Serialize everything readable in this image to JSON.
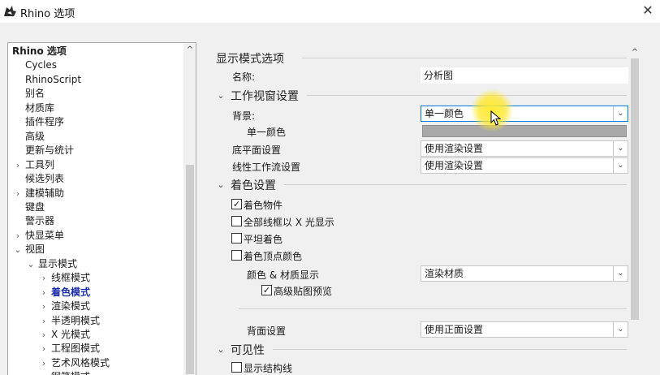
{
  "window": {
    "title": "Rhino 选项",
    "close_glyph": "✕",
    "icon": "rhino-icon"
  },
  "tree": {
    "items": [
      {
        "label": "Rhino 选项",
        "bold": true
      },
      {
        "label": "Cycles"
      },
      {
        "label": "RhinoScript"
      },
      {
        "label": "别名"
      },
      {
        "label": "材质库"
      },
      {
        "label": "插件程序"
      },
      {
        "label": "高级"
      },
      {
        "label": "更新与统计"
      },
      {
        "label": "工具列",
        "expander": "›"
      },
      {
        "label": "候选列表"
      },
      {
        "label": "建模辅助",
        "expander": "›"
      },
      {
        "label": "键盘"
      },
      {
        "label": "警示器"
      },
      {
        "label": "快显菜单",
        "expander": "›"
      },
      {
        "label": "视图",
        "expander": "⌄"
      },
      {
        "label": "显示模式",
        "expander": "⌄"
      },
      {
        "label": "线框模式",
        "expander": "›"
      },
      {
        "label": "着色模式",
        "expander": "›",
        "selected": true
      },
      {
        "label": "渲染模式",
        "expander": "›"
      },
      {
        "label": "半透明模式",
        "expander": "›"
      },
      {
        "label": "X 光模式",
        "expander": "›"
      },
      {
        "label": "工程图模式",
        "expander": "›"
      },
      {
        "label": "艺术风格模式",
        "expander": "›"
      },
      {
        "label": "钢笔模式",
        "expander": "›"
      }
    ]
  },
  "main": {
    "display_mode_section": "显示模式选项",
    "name_label": "名称:",
    "name_value": "分析图",
    "viewport_section": "工作视窗设置",
    "background_label": "背景:",
    "background_value": "单一颜色",
    "single_color_label": "单一颜色",
    "ground_plane_label": "底平面设置",
    "ground_plane_value": "使用渲染设置",
    "linear_workflow_label": "线性工作流设置",
    "linear_workflow_value": "使用渲染设置",
    "shading_section": "着色设置",
    "shade_objects_label": "着色物件",
    "shade_objects_checked": true,
    "xray_all_label": "全部线框以 X 光显示",
    "xray_all_checked": false,
    "flat_shading_label": "平坦着色",
    "flat_shading_checked": false,
    "vertex_colors_label": "着色顶点颜色",
    "vertex_colors_checked": false,
    "color_material_label": "颜色 & 材质显示",
    "color_material_value": "渲染材质",
    "adv_texture_label": "高级贴图预览",
    "adv_texture_checked": true,
    "backface_label": "背面设置",
    "backface_value": "使用正面设置",
    "visibility_section": "可见性",
    "show_isocurves_label": "显示结构线",
    "show_isocurves_checked": false,
    "check_glyph": "✓",
    "collapse_glyph": "⌄",
    "dropdown_glyph": "⌄",
    "scroll_up_glyph": "^"
  },
  "colors": {
    "swatch": "#a9a9a9",
    "selected_tree": "#1c2fa8",
    "cursor_highlight": "#ffeb28"
  }
}
